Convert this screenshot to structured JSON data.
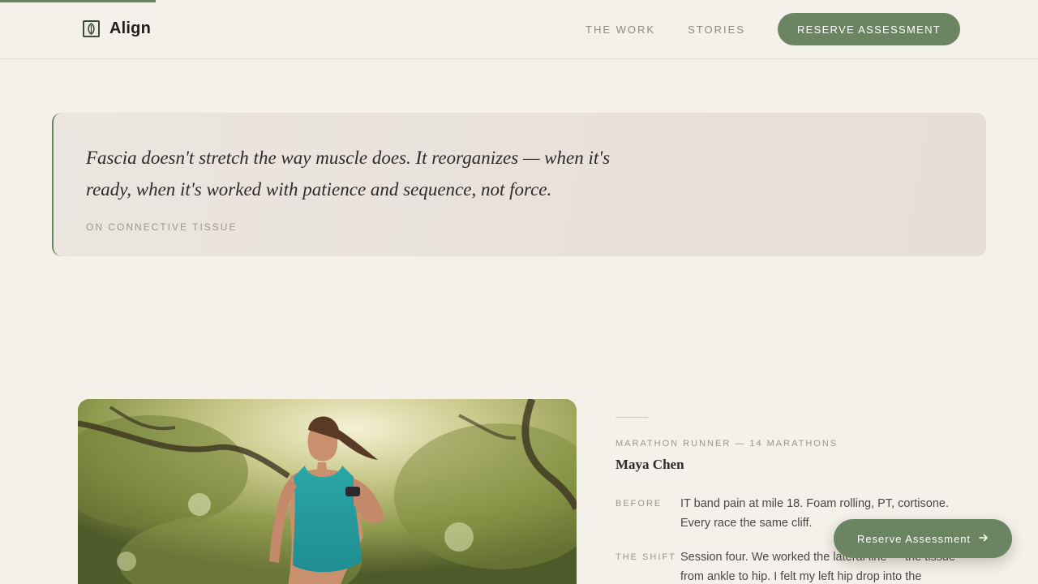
{
  "reading_progress": 0.15,
  "colors": {
    "accent": "#6b8462",
    "background": "#f4f0ea",
    "muted_text": "#9a958e"
  },
  "header": {
    "brand": "Align",
    "logo_icon": "leaf-icon",
    "nav": [
      "THE WORK",
      "STORIES"
    ],
    "cta": "RESERVE ASSESSMENT"
  },
  "quote": {
    "text": "Fascia doesn't stretch the way muscle does. It reorganizes — when it's ready, when it's worked with patience and sequence, not force.",
    "source": "ON CONNECTIVE TISSUE"
  },
  "story": {
    "image_icon": "runner-photo",
    "kicker": "MARATHON RUNNER — 14 MARATHONS",
    "name": "Maya Chen",
    "rows": [
      {
        "label": "BEFORE",
        "text": "IT band pain at mile 18. Foam rolling, PT, cortisone. Every race the same cliff."
      },
      {
        "label": "THE SHIFT",
        "text": "Session four. We worked the lateral line — the tissue from ankle to hip. I felt my left hip drop into the"
      }
    ]
  },
  "floating_cta": {
    "label": "Reserve Assessment",
    "icon": "arrow-right-icon"
  }
}
